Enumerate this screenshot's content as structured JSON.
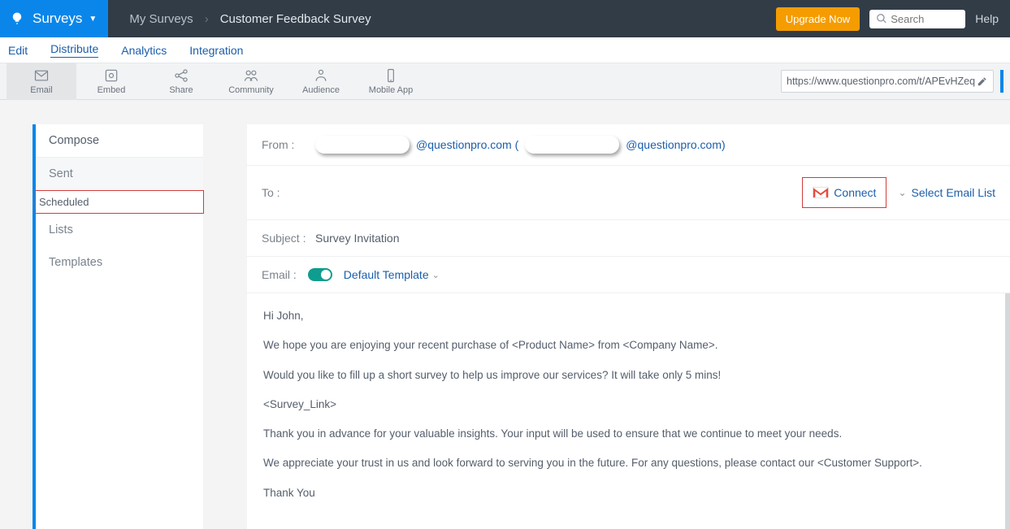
{
  "topbar": {
    "brand": "Surveys",
    "crumb1": "My Surveys",
    "crumb2": "Customer Feedback Survey",
    "upgrade": "Upgrade Now",
    "search_placeholder": "Search",
    "help": "Help"
  },
  "nav2": {
    "edit": "Edit",
    "distribute": "Distribute",
    "analytics": "Analytics",
    "integration": "Integration"
  },
  "toolbar": {
    "email": "Email",
    "embed": "Embed",
    "share": "Share",
    "community": "Community",
    "audience": "Audience",
    "mobile": "Mobile App",
    "url": "https://www.questionpro.com/t/APEvHZeq"
  },
  "side": {
    "compose": "Compose",
    "sent": "Sent",
    "scheduled": "Scheduled",
    "lists": "Lists",
    "templates": "Templates"
  },
  "compose": {
    "from_label": "From :",
    "from_domain1": "@questionpro.com (",
    "from_domain2": "@questionpro.com)",
    "to_label": "To :",
    "connect": "Connect",
    "select_list": "Select Email List",
    "subject_label": "Subject :",
    "subject_value": "Survey Invitation",
    "email_label": "Email :",
    "template": "Default Template"
  },
  "body": {
    "p1": "Hi John,",
    "p2": "We hope you are enjoying your recent purchase of <Product Name> from <Company Name>.",
    "p3": "Would you like to fill up a short survey to help us improve our services? It will take only 5 mins!",
    "p4": "<Survey_Link>",
    "p5": "Thank you in advance for your valuable insights.  Your input will be used to ensure that we continue to meet your needs.",
    "p6": "We appreciate your trust in us and look forward to serving you in the future. For any questions, please contact our <Customer Support>.",
    "p7": "Thank You"
  }
}
